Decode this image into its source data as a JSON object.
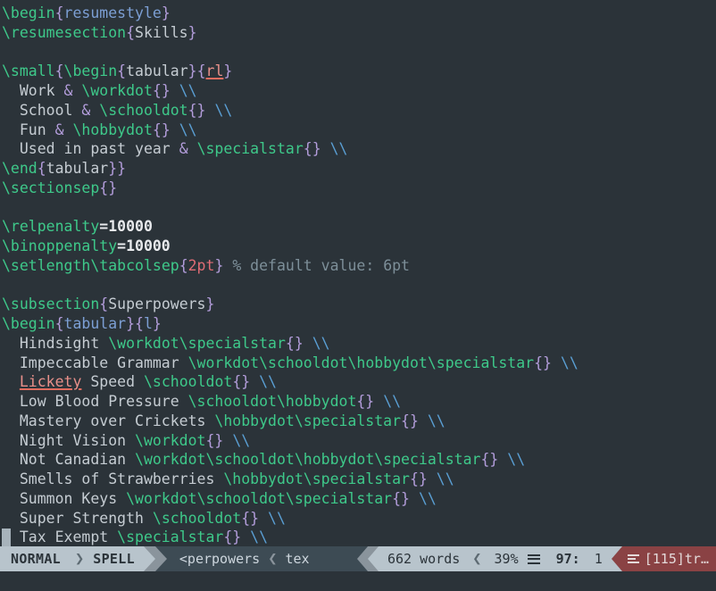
{
  "editor": {
    "background": "#2b3339",
    "lines": [
      {
        "id": "l1",
        "tokens": [
          {
            "t": "cmd",
            "v": "\\begin"
          },
          {
            "t": "brace",
            "v": "{"
          },
          {
            "t": "arg",
            "v": "resumestyle"
          },
          {
            "t": "brace",
            "v": "}"
          }
        ]
      },
      {
        "id": "l2",
        "tokens": [
          {
            "t": "cmd",
            "v": "\\resumesection"
          },
          {
            "t": "brace",
            "v": "{"
          },
          {
            "t": "plain",
            "v": "Skills"
          },
          {
            "t": "brace",
            "v": "}"
          }
        ]
      },
      {
        "id": "l3",
        "tokens": []
      },
      {
        "id": "l4",
        "tokens": [
          {
            "t": "cmd",
            "v": "\\small"
          },
          {
            "t": "brace",
            "v": "{"
          },
          {
            "t": "cmd",
            "v": "\\begin"
          },
          {
            "t": "brace",
            "v": "{"
          },
          {
            "t": "plain",
            "v": "tabular"
          },
          {
            "t": "brace",
            "v": "}"
          },
          {
            "t": "brace",
            "v": "{"
          },
          {
            "t": "spell",
            "v": "rl"
          },
          {
            "t": "brace",
            "v": "}"
          }
        ]
      },
      {
        "id": "l5",
        "tokens": [
          {
            "t": "plain",
            "v": "  Work "
          },
          {
            "t": "amp",
            "v": "&"
          },
          {
            "t": "plain",
            "v": " "
          },
          {
            "t": "cmd",
            "v": "\\workdot"
          },
          {
            "t": "brace",
            "v": "{}"
          },
          {
            "t": "plain",
            "v": " "
          },
          {
            "t": "nl",
            "v": "\\\\"
          }
        ]
      },
      {
        "id": "l6",
        "tokens": [
          {
            "t": "plain",
            "v": "  School "
          },
          {
            "t": "amp",
            "v": "&"
          },
          {
            "t": "plain",
            "v": " "
          },
          {
            "t": "cmd",
            "v": "\\schooldot"
          },
          {
            "t": "brace",
            "v": "{}"
          },
          {
            "t": "plain",
            "v": " "
          },
          {
            "t": "nl",
            "v": "\\\\"
          }
        ]
      },
      {
        "id": "l7",
        "tokens": [
          {
            "t": "plain",
            "v": "  Fun "
          },
          {
            "t": "amp",
            "v": "&"
          },
          {
            "t": "plain",
            "v": " "
          },
          {
            "t": "cmd",
            "v": "\\hobbydot"
          },
          {
            "t": "brace",
            "v": "{}"
          },
          {
            "t": "plain",
            "v": " "
          },
          {
            "t": "nl",
            "v": "\\\\"
          }
        ]
      },
      {
        "id": "l8",
        "tokens": [
          {
            "t": "plain",
            "v": "  Used in past year "
          },
          {
            "t": "amp",
            "v": "&"
          },
          {
            "t": "plain",
            "v": " "
          },
          {
            "t": "cmd",
            "v": "\\specialstar"
          },
          {
            "t": "brace",
            "v": "{}"
          },
          {
            "t": "plain",
            "v": " "
          },
          {
            "t": "nl",
            "v": "\\\\"
          }
        ]
      },
      {
        "id": "l9",
        "tokens": [
          {
            "t": "cmd",
            "v": "\\end"
          },
          {
            "t": "brace",
            "v": "{"
          },
          {
            "t": "plain",
            "v": "tabular"
          },
          {
            "t": "brace",
            "v": "}}"
          }
        ]
      },
      {
        "id": "l10",
        "tokens": [
          {
            "t": "cmd",
            "v": "\\sectionsep"
          },
          {
            "t": "brace",
            "v": "{}"
          }
        ]
      },
      {
        "id": "l11",
        "tokens": []
      },
      {
        "id": "l12",
        "tokens": [
          {
            "t": "cmd",
            "v": "\\relpenalty"
          },
          {
            "t": "numb",
            "v": "=10000"
          }
        ]
      },
      {
        "id": "l13",
        "tokens": [
          {
            "t": "cmd",
            "v": "\\binoppenalty"
          },
          {
            "t": "numb",
            "v": "=10000"
          }
        ]
      },
      {
        "id": "l14",
        "tokens": [
          {
            "t": "cmd",
            "v": "\\setlength"
          },
          {
            "t": "cmd",
            "v": "\\tabcolsep"
          },
          {
            "t": "brace",
            "v": "{"
          },
          {
            "t": "num",
            "v": "2pt"
          },
          {
            "t": "brace",
            "v": "}"
          },
          {
            "t": "plain",
            "v": " "
          },
          {
            "t": "comment",
            "v": "% default value: 6pt"
          }
        ]
      },
      {
        "id": "l15",
        "tokens": []
      },
      {
        "id": "l16",
        "tokens": [
          {
            "t": "cmd",
            "v": "\\subsection"
          },
          {
            "t": "brace",
            "v": "{"
          },
          {
            "t": "plain",
            "v": "Superpowers"
          },
          {
            "t": "brace",
            "v": "}"
          }
        ]
      },
      {
        "id": "l17",
        "tokens": [
          {
            "t": "cmd",
            "v": "\\begin"
          },
          {
            "t": "brace",
            "v": "{"
          },
          {
            "t": "arg",
            "v": "tabular"
          },
          {
            "t": "brace",
            "v": "}"
          },
          {
            "t": "brace",
            "v": "{"
          },
          {
            "t": "arg",
            "v": "l"
          },
          {
            "t": "brace",
            "v": "}"
          }
        ]
      },
      {
        "id": "l18",
        "tokens": [
          {
            "t": "plain",
            "v": "  Hindsight "
          },
          {
            "t": "cmd",
            "v": "\\workdot"
          },
          {
            "t": "cmd",
            "v": "\\specialstar"
          },
          {
            "t": "brace",
            "v": "{}"
          },
          {
            "t": "plain",
            "v": " "
          },
          {
            "t": "nl",
            "v": "\\\\"
          }
        ]
      },
      {
        "id": "l19",
        "tokens": [
          {
            "t": "plain",
            "v": "  Impeccable Grammar "
          },
          {
            "t": "cmd",
            "v": "\\workdot"
          },
          {
            "t": "cmd",
            "v": "\\schooldot"
          },
          {
            "t": "cmd",
            "v": "\\hobbydot"
          },
          {
            "t": "cmd",
            "v": "\\specialstar"
          },
          {
            "t": "brace",
            "v": "{}"
          },
          {
            "t": "plain",
            "v": " "
          },
          {
            "t": "nl",
            "v": "\\\\"
          }
        ]
      },
      {
        "id": "l20",
        "tokens": [
          {
            "t": "plain",
            "v": "  "
          },
          {
            "t": "spell",
            "v": "Lickety"
          },
          {
            "t": "plain",
            "v": " Speed "
          },
          {
            "t": "cmd",
            "v": "\\schooldot"
          },
          {
            "t": "brace",
            "v": "{}"
          },
          {
            "t": "plain",
            "v": " "
          },
          {
            "t": "nl",
            "v": "\\\\"
          }
        ]
      },
      {
        "id": "l21",
        "tokens": [
          {
            "t": "plain",
            "v": "  Low Blood Pressure "
          },
          {
            "t": "cmd",
            "v": "\\schooldot"
          },
          {
            "t": "cmd",
            "v": "\\hobbydot"
          },
          {
            "t": "brace",
            "v": "{}"
          },
          {
            "t": "plain",
            "v": " "
          },
          {
            "t": "nl",
            "v": "\\\\"
          }
        ]
      },
      {
        "id": "l22",
        "tokens": [
          {
            "t": "plain",
            "v": "  Mastery over Crickets "
          },
          {
            "t": "cmd",
            "v": "\\hobbydot"
          },
          {
            "t": "cmd",
            "v": "\\specialstar"
          },
          {
            "t": "brace",
            "v": "{}"
          },
          {
            "t": "plain",
            "v": " "
          },
          {
            "t": "nl",
            "v": "\\\\"
          }
        ]
      },
      {
        "id": "l23",
        "tokens": [
          {
            "t": "plain",
            "v": "  Night Vision "
          },
          {
            "t": "cmd",
            "v": "\\workdot"
          },
          {
            "t": "brace",
            "v": "{}"
          },
          {
            "t": "plain",
            "v": " "
          },
          {
            "t": "nl",
            "v": "\\\\"
          }
        ]
      },
      {
        "id": "l24",
        "tokens": [
          {
            "t": "plain",
            "v": "  Not Canadian "
          },
          {
            "t": "cmd",
            "v": "\\workdot"
          },
          {
            "t": "cmd",
            "v": "\\schooldot"
          },
          {
            "t": "cmd",
            "v": "\\hobbydot"
          },
          {
            "t": "cmd",
            "v": "\\specialstar"
          },
          {
            "t": "brace",
            "v": "{}"
          },
          {
            "t": "plain",
            "v": " "
          },
          {
            "t": "nl",
            "v": "\\\\"
          }
        ]
      },
      {
        "id": "l25",
        "tokens": [
          {
            "t": "plain",
            "v": "  Smells of Strawberries "
          },
          {
            "t": "cmd",
            "v": "\\hobbydot"
          },
          {
            "t": "cmd",
            "v": "\\specialstar"
          },
          {
            "t": "brace",
            "v": "{}"
          },
          {
            "t": "plain",
            "v": " "
          },
          {
            "t": "nl",
            "v": "\\\\"
          }
        ]
      },
      {
        "id": "l26",
        "tokens": [
          {
            "t": "plain",
            "v": "  Summon Keys "
          },
          {
            "t": "cmd",
            "v": "\\workdot"
          },
          {
            "t": "cmd",
            "v": "\\schooldot"
          },
          {
            "t": "cmd",
            "v": "\\specialstar"
          },
          {
            "t": "brace",
            "v": "{}"
          },
          {
            "t": "plain",
            "v": " "
          },
          {
            "t": "nl",
            "v": "\\\\"
          }
        ]
      },
      {
        "id": "l27",
        "tokens": [
          {
            "t": "plain",
            "v": "  Super Strength "
          },
          {
            "t": "cmd",
            "v": "\\schooldot"
          },
          {
            "t": "brace",
            "v": "{}"
          },
          {
            "t": "plain",
            "v": " "
          },
          {
            "t": "nl",
            "v": "\\\\"
          }
        ]
      },
      {
        "id": "l28",
        "cursor": true,
        "tokens": [
          {
            "t": "plain",
            "v": "  Tax Exempt "
          },
          {
            "t": "cmd",
            "v": "\\specialstar"
          },
          {
            "t": "brace",
            "v": "{}"
          },
          {
            "t": "plain",
            "v": " "
          },
          {
            "t": "nl",
            "v": "\\\\"
          }
        ]
      }
    ]
  },
  "statusline": {
    "mode": "NORMAL",
    "mode_separator": "❯",
    "spell": "SPELL",
    "filename": "<perpowers",
    "file_separator": "❮",
    "filetype": "tex",
    "words": "662 words",
    "words_separator": "❮",
    "percent": "39%",
    "lines_icon": "lines-icon",
    "line_number": "97:",
    "column_number": "1",
    "warning_icon": "diff-lines-icon",
    "warning_text": "[115]tr…",
    "colors": {
      "mode_bg": "#b8c4cc",
      "mode_fg": "#2b3339",
      "file_bg": "#3d4b54",
      "file_fg": "#cdd6dd",
      "warn_bg": "#8a4244",
      "warn_fg": "#e4dada"
    }
  }
}
